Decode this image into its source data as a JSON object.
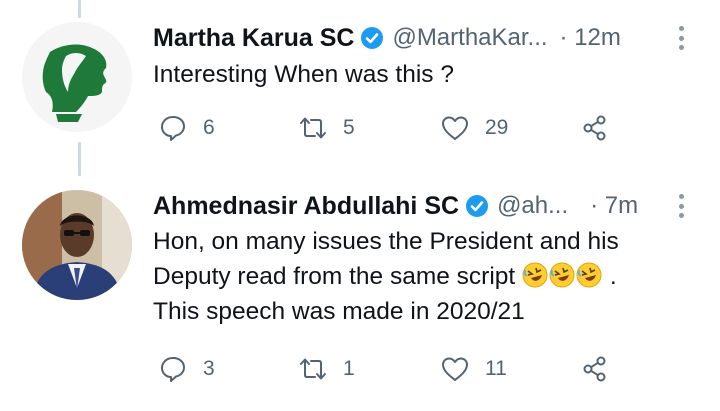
{
  "tweets": [
    {
      "name": "Martha Karua SC",
      "handle": "@MarthaKar...",
      "time": "· 12m",
      "text_lines": [
        "Interesting When was this ?"
      ],
      "replies": "6",
      "retweets": "5",
      "likes": "29"
    },
    {
      "name": "Ahmednasir Abdullahi SC",
      "handle": "@ah...",
      "time": "· 7m",
      "text_line1": "Hon, on many issues the President and his",
      "text_line2_prefix": "Deputy read from the same script",
      "text_line2_suffix": ".",
      "text_line3": "This speech was made in 2020/21",
      "emoji_icon": "rolling-on-floor-laughing",
      "replies": "3",
      "retweets": "1",
      "likes": "11"
    }
  ],
  "colors": {
    "verified": "#1d9bf0",
    "secondary_text": "#536471",
    "avatar1_bg": "#f5f5f5",
    "avatar1_fg": "#1f7a3a",
    "thread_line": "#cfd9de"
  }
}
